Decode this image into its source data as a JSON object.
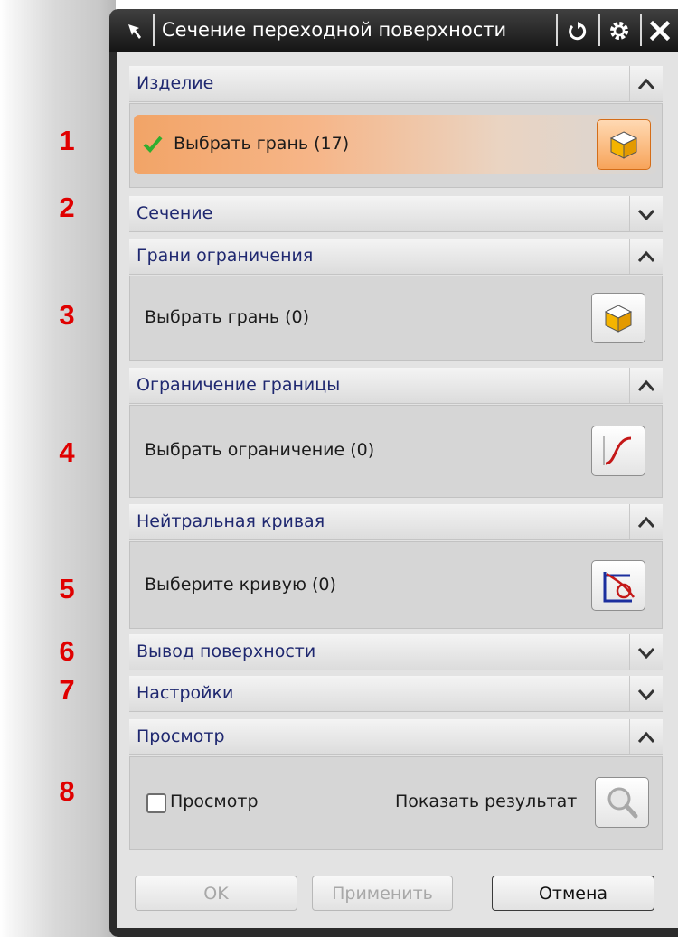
{
  "dialog": {
    "title": "Сечение переходной поверхности"
  },
  "numbers": [
    "1",
    "2",
    "3",
    "4",
    "5",
    "6",
    "7",
    "8"
  ],
  "sections": {
    "product": {
      "header": "Изделие",
      "select_label": "Выбрать грань (17)"
    },
    "section": {
      "header": "Сечение"
    },
    "limit_faces": {
      "header": "Грани ограничения",
      "select_label": "Выбрать грань (0)"
    },
    "boundary_limit": {
      "header": "Ограничение границы",
      "select_label": "Выбрать ограничение (0)"
    },
    "neutral_curve": {
      "header": "Нейтральная кривая",
      "select_label": "Выберите кривую (0)"
    },
    "surface_output": {
      "header": "Вывод поверхности"
    },
    "settings": {
      "header": "Настройки"
    },
    "preview": {
      "header": "Просмотр",
      "checkbox_label": "Просмотр",
      "show_result_label": "Показать результат"
    }
  },
  "buttons": {
    "ok": "OK",
    "apply": "Применить",
    "cancel": "Отмена"
  },
  "colors": {
    "accent_orange": "#f2a467",
    "check_green": "#2fae2f",
    "header_text": "#1f2870",
    "marker_red": "#e00000"
  }
}
